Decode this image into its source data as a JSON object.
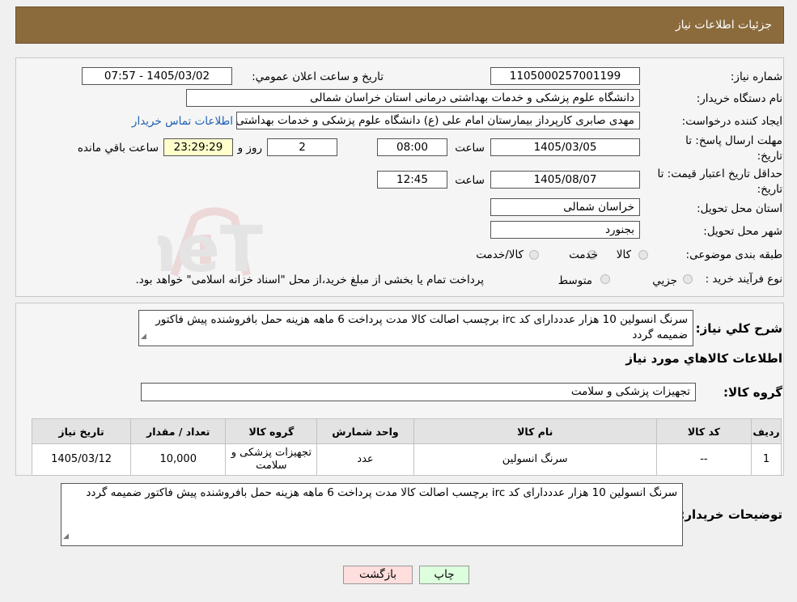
{
  "header": {
    "title": "جزئیات اطلاعات نیاز"
  },
  "info": {
    "need_number_label": "شماره نیاز:",
    "need_number": "1105000257001199",
    "announce_label": "تاریخ و ساعت اعلان عمومي:",
    "announce_value": "1405/03/02 - 07:57",
    "buyer_org_label": "نام دستگاه خريدار:",
    "buyer_org": "دانشگاه علوم پزشکی و خدمات بهداشتی درمانی استان خراسان شمالی",
    "requester_label": "ايجاد کننده درخواست:",
    "requester": "مهدی صابری کارپرداز بیمارستان امام علی (ع) دانشگاه علوم پزشکی و خدمات بهداشتی",
    "contact_link": "اطلاعات تماس خريدار",
    "deadline_label_1": "مهلت ارسال پاسخ: تا",
    "deadline_label_2": "تاريخ:",
    "deadline_date": "1405/03/05",
    "time_label": "ساعت",
    "deadline_time": "08:00",
    "days": "2",
    "days_label": "روز و",
    "remaining": "23:29:29",
    "remaining_label": "ساعت باقي مانده",
    "validity_label_1": "حداقل تاريخ اعتبار قيمت: تا",
    "validity_label_2": "تاريخ:",
    "validity_date": "1405/08/07",
    "validity_time": "12:45",
    "province_label": "استان محل تحويل:",
    "province": "خراسان شمالی",
    "city_label": "شهر محل تحويل:",
    "city": "بجنورد",
    "category_label": "طبقه بندی موضوعی:",
    "category_options": [
      "کالا",
      "خدمت",
      "کالا/خدمت"
    ],
    "process_label": "نوع فرآيند خريد :",
    "process_options": [
      "جزيي",
      "متوسط"
    ],
    "process_note": "پرداخت تمام یا بخشی از مبلغ خرید،از محل \"اسناد خزانه اسلامی\" خواهد بود."
  },
  "description": {
    "label": "شرح کلي نياز:",
    "text": "سرنگ انسولین 10 هزار عدددارای کد irc برچسب اصالت کالا مدت پرداخت 6 ماهه هزینه حمل بافروشنده پیش فاکتور ضمیمه گردد"
  },
  "goods_title": "اطلاعات کالاهاي مورد نياز",
  "goods_group_label": "گروه کالا:",
  "goods_group": "تجهیزات پزشکی و سلامت",
  "table": {
    "headers": [
      "رديف",
      "کد کالا",
      "نام کالا",
      "واحد شمارش",
      "گروه کالا",
      "تعداد / مقدار",
      "تاريخ نياز"
    ],
    "rows": [
      [
        "1",
        "--",
        "سرنگ انسولین",
        "عدد",
        "تجهیزات پزشکی و سلامت",
        "10,000",
        "1405/03/12"
      ]
    ]
  },
  "buyer_notes": {
    "label": "توضيحات خريدار:",
    "text": "سرنگ انسولین 10 هزار عدددارای کد irc برچسب اصالت کالا مدت پرداخت 6 ماهه هزینه حمل بافروشنده پیش فاکتور ضمیمه گردد"
  },
  "buttons": {
    "print": "چاپ",
    "back": "بازگشت"
  },
  "watermark": {
    "text": "AriaTender.neT"
  },
  "colors": {
    "header_bg": "#8b6b3c",
    "link": "#1a5fb4",
    "print_btn": "#ddffdd",
    "back_btn": "#ffdede"
  }
}
